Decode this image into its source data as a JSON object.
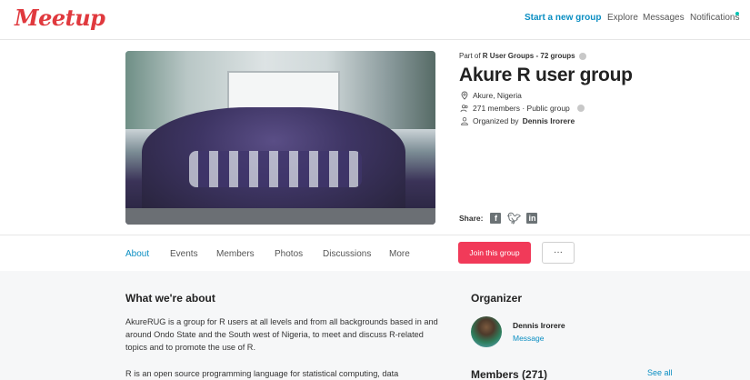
{
  "nav": {
    "logo": "Meetup",
    "start_group": "Start a new group",
    "explore": "Explore",
    "messages": "Messages",
    "notifications": "Notifications"
  },
  "group": {
    "part_of_prefix": "Part of ",
    "part_of_link": "R User Groups - 72 groups",
    "title": "Akure R user group",
    "location": "Akure, Nigeria",
    "members_summary": "271 members · Public group",
    "organized_prefix": "Organized by ",
    "organizer": "Dennis Irorere",
    "share_label": "Share:"
  },
  "tabs": [
    "About",
    "Events",
    "Members",
    "Photos",
    "Discussions",
    "More"
  ],
  "actions": {
    "join": "Join this group",
    "more": "···"
  },
  "about": {
    "heading": "What we're about",
    "paragraph1": "AkureRUG is a group for R users at all levels and from all backgrounds based in and around Ondo State and the South west of Nigeria, to meet and discuss R-related topics and to promote the use of R.",
    "paragraph2": "R is an open source programming language for statistical computing, data"
  },
  "sidebar": {
    "organizer_heading": "Organizer",
    "organizer_name": "Dennis Irorere",
    "message_link": "Message",
    "members_heading": "Members (271)",
    "see_all": "See all"
  },
  "colors": {
    "brand": "#e0393e",
    "accent": "#0a8ec2",
    "join_button": "#f13a59",
    "notification_dot": "#00c3b3"
  },
  "icons": [
    "location-pin-icon",
    "members-icon",
    "info-icon",
    "person-icon",
    "facebook-icon",
    "twitter-icon",
    "linkedin-icon"
  ]
}
